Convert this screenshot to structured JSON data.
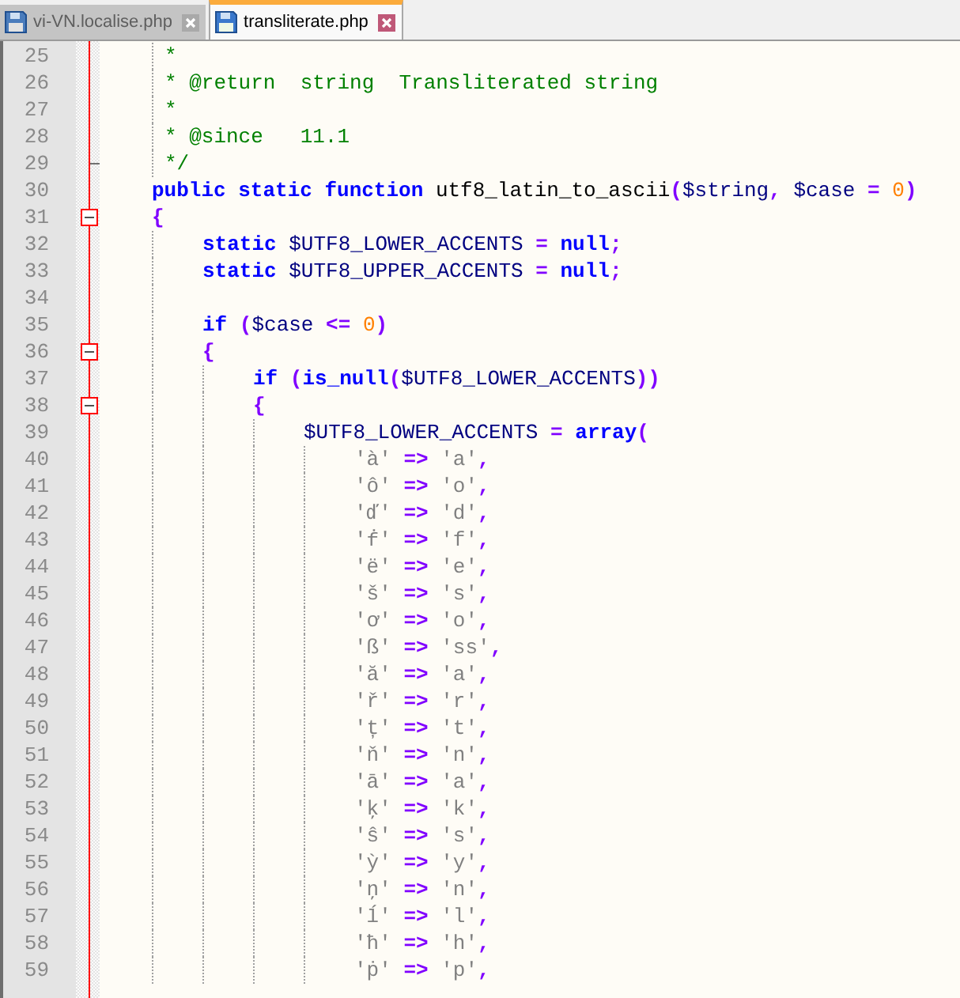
{
  "tabs": [
    {
      "label": "vi-VN.localise.php",
      "selected": false
    },
    {
      "label": "transliterate.php",
      "selected": true
    }
  ],
  "editor": {
    "lines": [
      {
        "number": "25",
        "code": [
          {
            "kind": "comment",
            "text": "     *"
          }
        ]
      },
      {
        "number": "26",
        "code": [
          {
            "kind": "comment",
            "text": "     * @return  string  Transliterated string"
          }
        ]
      },
      {
        "number": "27",
        "code": [
          {
            "kind": "comment",
            "text": "     *"
          }
        ]
      },
      {
        "number": "28",
        "code": [
          {
            "kind": "comment",
            "text": "     * @since   11.1"
          }
        ]
      },
      {
        "number": "29",
        "fold": {
          "kind": "end"
        },
        "code": [
          {
            "kind": "comment",
            "text": "     */"
          }
        ]
      },
      {
        "number": "30",
        "code": [
          {
            "kind": "keyword",
            "text": "    public static function"
          },
          {
            "kind": "plain",
            "text": " utf8_latin_to_ascii"
          },
          {
            "kind": "operator",
            "text": "("
          },
          {
            "kind": "variable",
            "text": "$string"
          },
          {
            "kind": "operator",
            "text": ","
          },
          {
            "kind": "variable",
            "text": " $case"
          },
          {
            "kind": "operator",
            "text": " ="
          },
          {
            "kind": "number",
            "text": " 0"
          },
          {
            "kind": "operator",
            "text": ")"
          }
        ]
      },
      {
        "number": "31",
        "fold": {
          "kind": "box",
          "expanded": true
        },
        "code": [
          {
            "kind": "operator",
            "text": "    {"
          }
        ]
      },
      {
        "number": "32",
        "code": [
          {
            "kind": "keyword",
            "text": "        static"
          },
          {
            "kind": "variable",
            "text": " $UTF8_LOWER_ACCENTS"
          },
          {
            "kind": "operator",
            "text": " ="
          },
          {
            "kind": "keyword",
            "text": " null"
          },
          {
            "kind": "operator",
            "text": ";"
          }
        ]
      },
      {
        "number": "33",
        "code": [
          {
            "kind": "keyword",
            "text": "        static"
          },
          {
            "kind": "variable",
            "text": " $UTF8_UPPER_ACCENTS"
          },
          {
            "kind": "operator",
            "text": " ="
          },
          {
            "kind": "keyword",
            "text": " null"
          },
          {
            "kind": "operator",
            "text": ";"
          }
        ]
      },
      {
        "number": "34"
      },
      {
        "number": "35",
        "code": [
          {
            "kind": "keyword",
            "text": "        if"
          },
          {
            "kind": "operator",
            "text": " ("
          },
          {
            "kind": "variable",
            "text": "$case"
          },
          {
            "kind": "operator",
            "text": " <="
          },
          {
            "kind": "number",
            "text": " 0"
          },
          {
            "kind": "operator",
            "text": ")"
          }
        ]
      },
      {
        "number": "36",
        "fold": {
          "kind": "box",
          "expanded": true
        },
        "code": [
          {
            "kind": "operator",
            "text": "        {"
          }
        ]
      },
      {
        "number": "37",
        "code": [
          {
            "kind": "keyword",
            "text": "            if"
          },
          {
            "kind": "operator",
            "text": " ("
          },
          {
            "kind": "keyword",
            "text": "is_null"
          },
          {
            "kind": "operator",
            "text": "("
          },
          {
            "kind": "variable",
            "text": "$UTF8_LOWER_ACCENTS"
          },
          {
            "kind": "operator",
            "text": "))"
          }
        ]
      },
      {
        "number": "38",
        "fold": {
          "kind": "box",
          "expanded": true
        },
        "code": [
          {
            "kind": "operator",
            "text": "            {"
          }
        ]
      },
      {
        "number": "39",
        "code": [
          {
            "kind": "variable",
            "text": "                $UTF8_LOWER_ACCENTS"
          },
          {
            "kind": "operator",
            "text": " ="
          },
          {
            "kind": "keyword",
            "text": " array"
          },
          {
            "kind": "operator",
            "text": "("
          }
        ]
      },
      {
        "number": "40",
        "code": [
          {
            "kind": "string",
            "text": "                    'à'"
          },
          {
            "kind": "operator",
            "text": " =>"
          },
          {
            "kind": "string",
            "text": " 'a'"
          },
          {
            "kind": "operator",
            "text": ","
          }
        ]
      },
      {
        "number": "41",
        "code": [
          {
            "kind": "string",
            "text": "                    'ô'"
          },
          {
            "kind": "operator",
            "text": " =>"
          },
          {
            "kind": "string",
            "text": " 'o'"
          },
          {
            "kind": "operator",
            "text": ","
          }
        ]
      },
      {
        "number": "42",
        "code": [
          {
            "kind": "string",
            "text": "                    'ď'"
          },
          {
            "kind": "operator",
            "text": " =>"
          },
          {
            "kind": "string",
            "text": " 'd'"
          },
          {
            "kind": "operator",
            "text": ","
          }
        ]
      },
      {
        "number": "43",
        "code": [
          {
            "kind": "string",
            "text": "                    'ḟ'"
          },
          {
            "kind": "operator",
            "text": " =>"
          },
          {
            "kind": "string",
            "text": " 'f'"
          },
          {
            "kind": "operator",
            "text": ","
          }
        ]
      },
      {
        "number": "44",
        "code": [
          {
            "kind": "string",
            "text": "                    'ë'"
          },
          {
            "kind": "operator",
            "text": " =>"
          },
          {
            "kind": "string",
            "text": " 'e'"
          },
          {
            "kind": "operator",
            "text": ","
          }
        ]
      },
      {
        "number": "45",
        "code": [
          {
            "kind": "string",
            "text": "                    'š'"
          },
          {
            "kind": "operator",
            "text": " =>"
          },
          {
            "kind": "string",
            "text": " 's'"
          },
          {
            "kind": "operator",
            "text": ","
          }
        ]
      },
      {
        "number": "46",
        "code": [
          {
            "kind": "string",
            "text": "                    'ơ'"
          },
          {
            "kind": "operator",
            "text": " =>"
          },
          {
            "kind": "string",
            "text": " 'o'"
          },
          {
            "kind": "operator",
            "text": ","
          }
        ]
      },
      {
        "number": "47",
        "code": [
          {
            "kind": "string",
            "text": "                    'ß'"
          },
          {
            "kind": "operator",
            "text": " =>"
          },
          {
            "kind": "string",
            "text": " 'ss'"
          },
          {
            "kind": "operator",
            "text": ","
          }
        ]
      },
      {
        "number": "48",
        "code": [
          {
            "kind": "string",
            "text": "                    'ă'"
          },
          {
            "kind": "operator",
            "text": " =>"
          },
          {
            "kind": "string",
            "text": " 'a'"
          },
          {
            "kind": "operator",
            "text": ","
          }
        ]
      },
      {
        "number": "49",
        "code": [
          {
            "kind": "string",
            "text": "                    'ř'"
          },
          {
            "kind": "operator",
            "text": " =>"
          },
          {
            "kind": "string",
            "text": " 'r'"
          },
          {
            "kind": "operator",
            "text": ","
          }
        ]
      },
      {
        "number": "50",
        "code": [
          {
            "kind": "string",
            "text": "                    'ț'"
          },
          {
            "kind": "operator",
            "text": " =>"
          },
          {
            "kind": "string",
            "text": " 't'"
          },
          {
            "kind": "operator",
            "text": ","
          }
        ]
      },
      {
        "number": "51",
        "code": [
          {
            "kind": "string",
            "text": "                    'ň'"
          },
          {
            "kind": "operator",
            "text": " =>"
          },
          {
            "kind": "string",
            "text": " 'n'"
          },
          {
            "kind": "operator",
            "text": ","
          }
        ]
      },
      {
        "number": "52",
        "code": [
          {
            "kind": "string",
            "text": "                    'ā'"
          },
          {
            "kind": "operator",
            "text": " =>"
          },
          {
            "kind": "string",
            "text": " 'a'"
          },
          {
            "kind": "operator",
            "text": ","
          }
        ]
      },
      {
        "number": "53",
        "code": [
          {
            "kind": "string",
            "text": "                    'ķ'"
          },
          {
            "kind": "operator",
            "text": " =>"
          },
          {
            "kind": "string",
            "text": " 'k'"
          },
          {
            "kind": "operator",
            "text": ","
          }
        ]
      },
      {
        "number": "54",
        "code": [
          {
            "kind": "string",
            "text": "                    'ŝ'"
          },
          {
            "kind": "operator",
            "text": " =>"
          },
          {
            "kind": "string",
            "text": " 's'"
          },
          {
            "kind": "operator",
            "text": ","
          }
        ]
      },
      {
        "number": "55",
        "code": [
          {
            "kind": "string",
            "text": "                    'ỳ'"
          },
          {
            "kind": "operator",
            "text": " =>"
          },
          {
            "kind": "string",
            "text": " 'y'"
          },
          {
            "kind": "operator",
            "text": ","
          }
        ]
      },
      {
        "number": "56",
        "code": [
          {
            "kind": "string",
            "text": "                    'ņ'"
          },
          {
            "kind": "operator",
            "text": " =>"
          },
          {
            "kind": "string",
            "text": " 'n'"
          },
          {
            "kind": "operator",
            "text": ","
          }
        ]
      },
      {
        "number": "57",
        "code": [
          {
            "kind": "string",
            "text": "                    'ĺ'"
          },
          {
            "kind": "operator",
            "text": " =>"
          },
          {
            "kind": "string",
            "text": " 'l'"
          },
          {
            "kind": "operator",
            "text": ","
          }
        ]
      },
      {
        "number": "58",
        "code": [
          {
            "kind": "string",
            "text": "                    'ħ'"
          },
          {
            "kind": "operator",
            "text": " =>"
          },
          {
            "kind": "string",
            "text": " 'h'"
          },
          {
            "kind": "operator",
            "text": ","
          }
        ]
      },
      {
        "number": "59",
        "code": [
          {
            "kind": "string",
            "text": "                    'ṗ'"
          },
          {
            "kind": "operator",
            "text": " =>"
          },
          {
            "kind": "string",
            "text": " 'p'"
          },
          {
            "kind": "operator",
            "text": ","
          }
        ]
      }
    ]
  }
}
